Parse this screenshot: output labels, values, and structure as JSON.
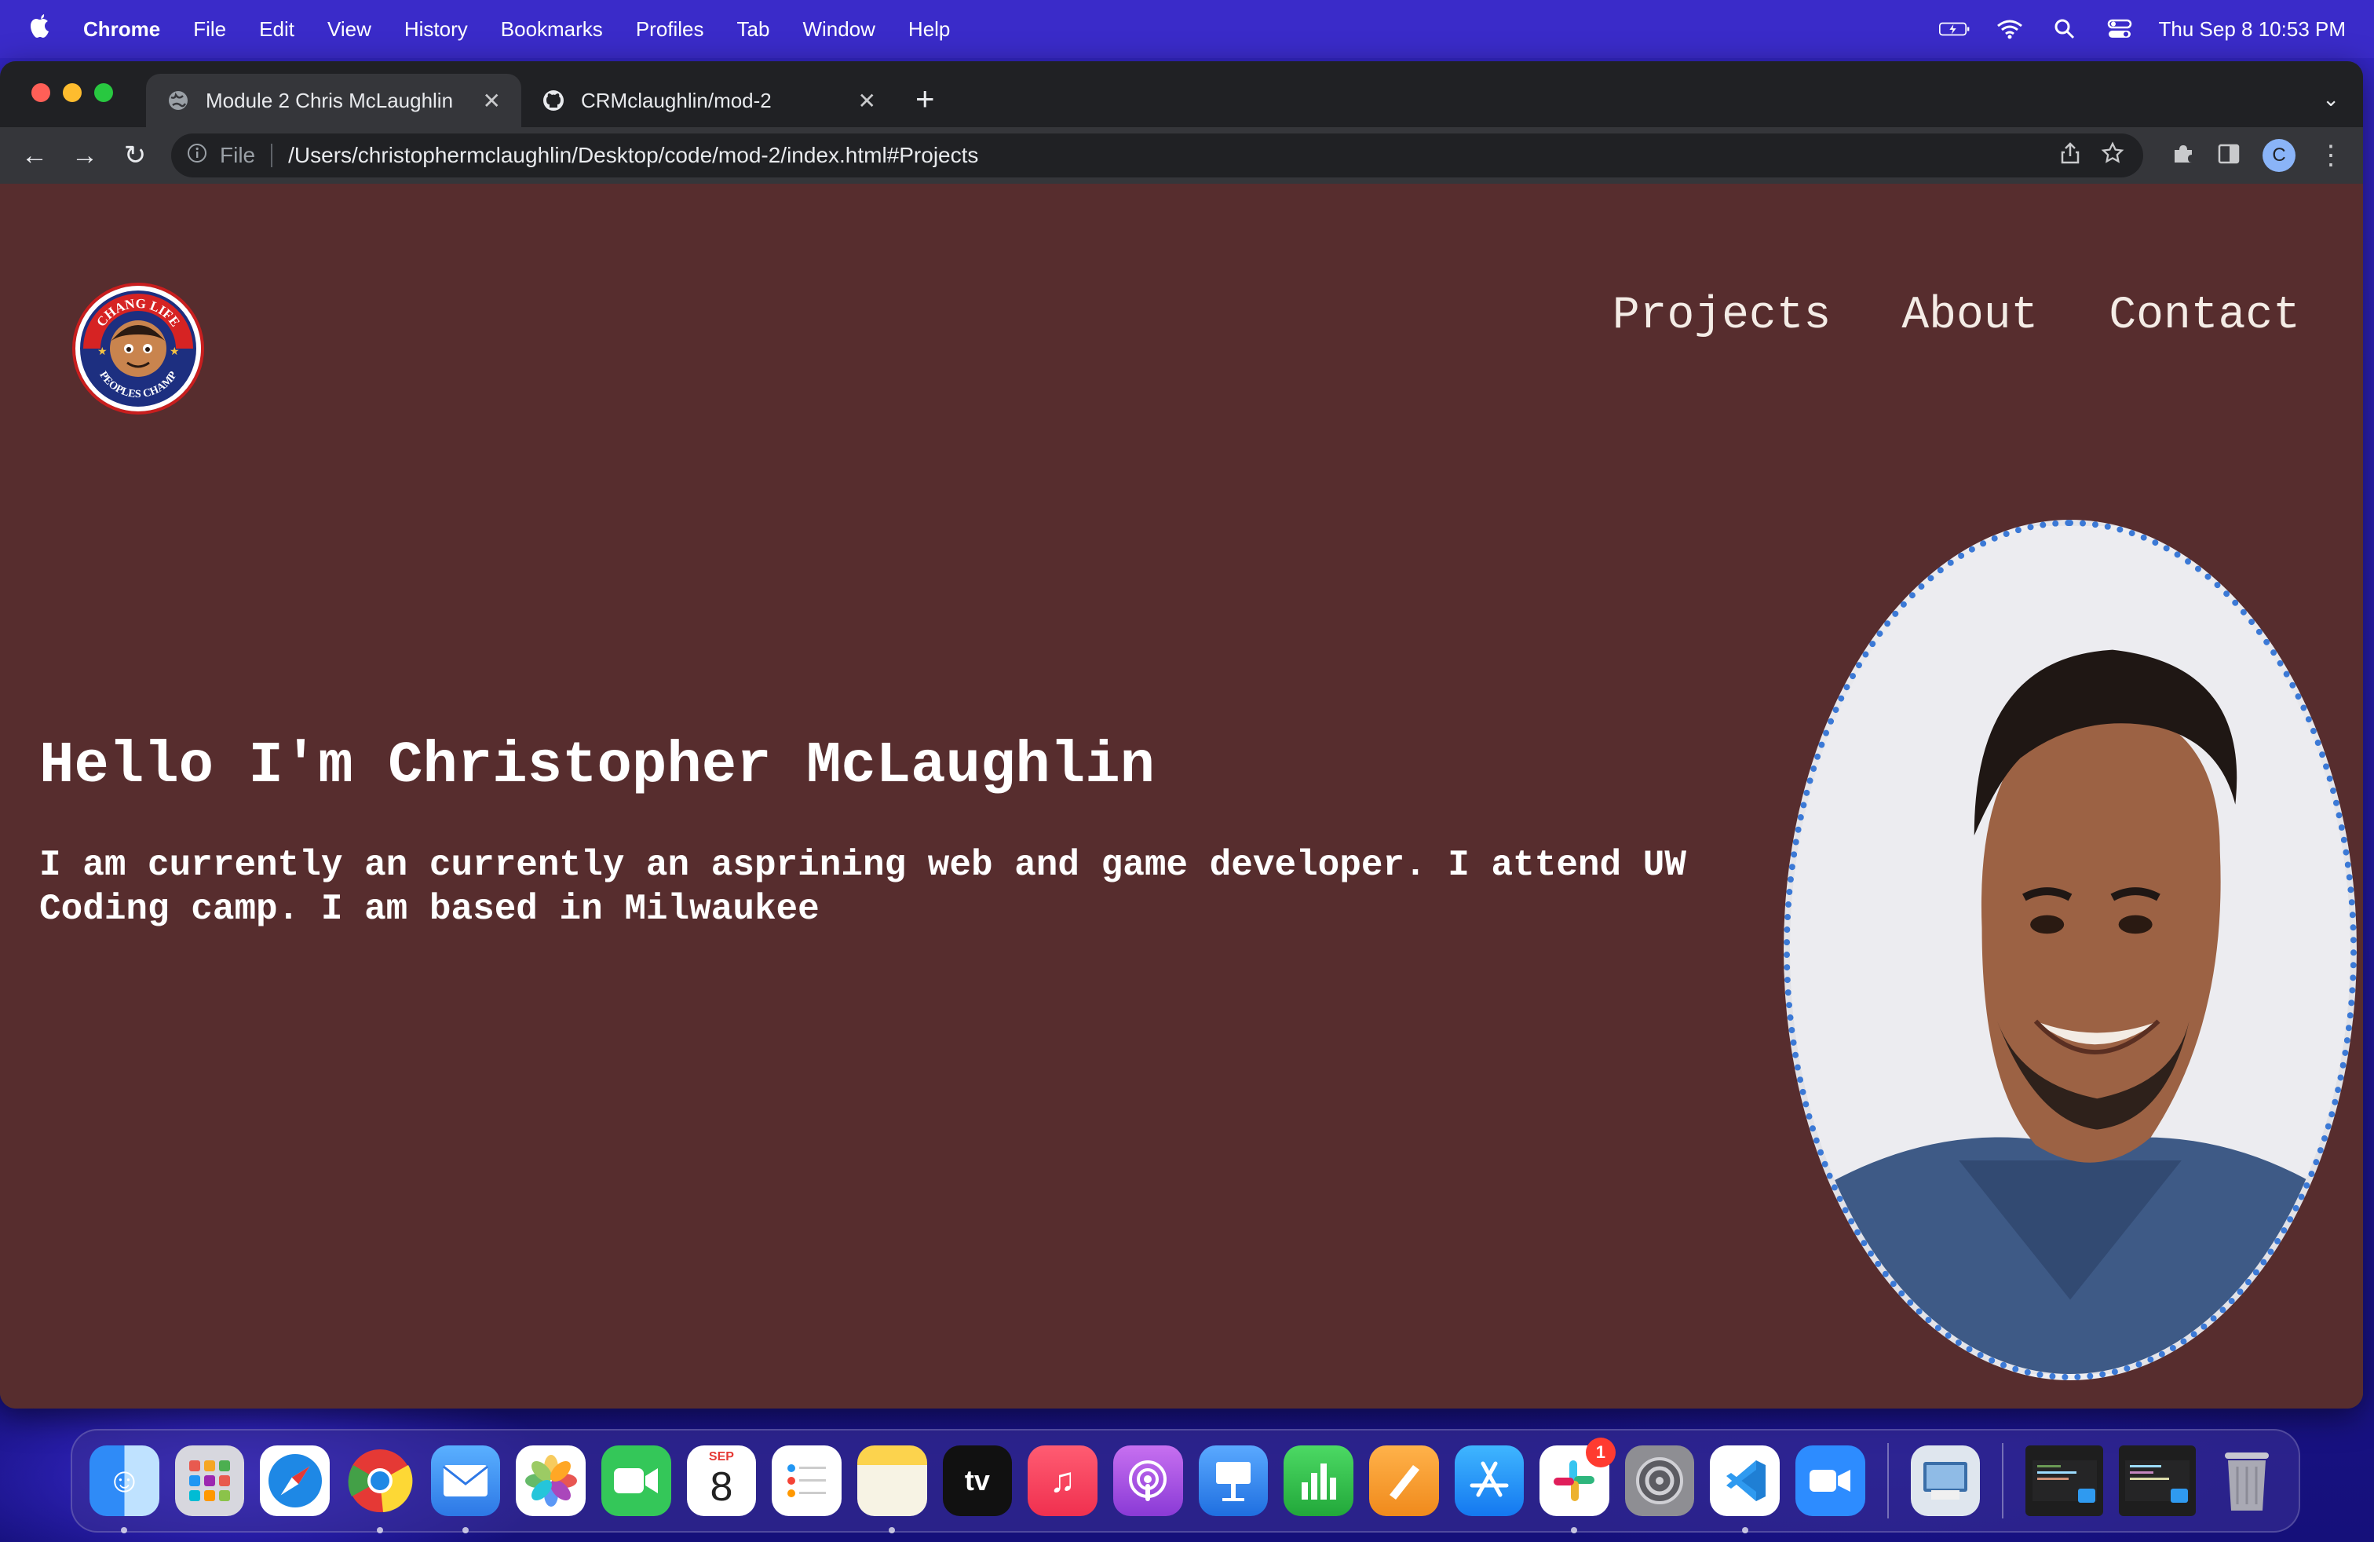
{
  "menubar": {
    "app": "Chrome",
    "items": [
      "File",
      "Edit",
      "View",
      "History",
      "Bookmarks",
      "Profiles",
      "Tab",
      "Window",
      "Help"
    ],
    "clock": "Thu Sep 8  10:53 PM"
  },
  "browser": {
    "tabs": [
      {
        "title": "Module 2 Chris McLaughlin",
        "icon": "globe-icon",
        "active": true
      },
      {
        "title": "CRMclaughlin/mod-2",
        "icon": "github-icon",
        "active": false
      }
    ],
    "address": {
      "scheme": "File",
      "url": "/Users/christophermclaughlin/Desktop/code/mod-2/index.html#Projects"
    },
    "profile_initial": "C"
  },
  "page": {
    "nav": [
      "Projects",
      "About",
      "Contact"
    ],
    "logo_top_text": "CHANG LIFE",
    "logo_bottom_text": "PEOPLES CHAMP",
    "hero_title": "Hello I'm Christopher McLaughlin",
    "hero_text": "I am currently an currently an asprining web and game developer. I attend UW Coding camp. I am based in Milwaukee",
    "background_color": "#572d2e",
    "portrait_border_color": "#3b79d6"
  },
  "dock": {
    "calendar_month": "SEP",
    "calendar_day": "8",
    "slack_badge": "1",
    "apps": [
      "finder-icon",
      "launchpad-icon",
      "safari-icon",
      "chrome-icon",
      "mail-icon",
      "photos-icon",
      "facetime-icon",
      "calendar-icon",
      "reminders-icon",
      "notes-icon",
      "appletv-icon",
      "music-icon",
      "podcasts-icon",
      "keynote-icon",
      "numbers-icon",
      "pages-icon",
      "appstore-icon",
      "slack-icon",
      "system-preferences-icon",
      "vscode-icon",
      "zoom-icon",
      "preview-icon",
      "vscode-window-thumb-1",
      "vscode-window-thumb-2",
      "trash-icon"
    ]
  }
}
